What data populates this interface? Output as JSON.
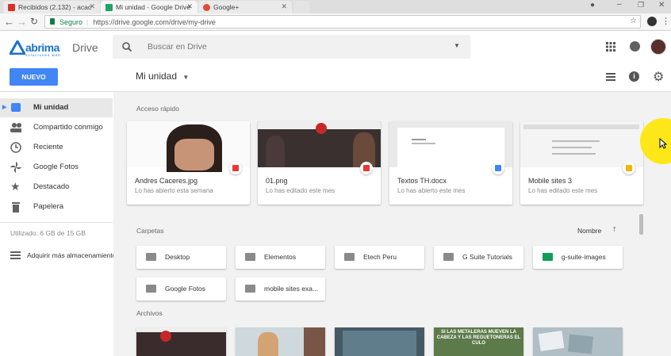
{
  "browser": {
    "tabs": [
      {
        "label": "Recibidos (2.132) - acac",
        "color": "#d93025"
      },
      {
        "label": "Mi unidad - Google Drive",
        "color": "#1fa463"
      },
      {
        "label": "Google+",
        "color": "#dd4b39"
      }
    ],
    "secure_label": "Seguro",
    "url": "https://drive.google.com/drive/my-drive"
  },
  "header": {
    "logo_text": "abrima",
    "logo_sub": "soluciones web",
    "product": "Drive",
    "search_placeholder": "Buscar en Drive"
  },
  "toolbar": {
    "new_label": "NUEVO",
    "title": "Mi unidad"
  },
  "sidebar": {
    "items": [
      {
        "label": "Mi unidad",
        "icon": "drive-icon"
      },
      {
        "label": "Compartido conmigo",
        "icon": "people-icon"
      },
      {
        "label": "Reciente",
        "icon": "clock-icon"
      },
      {
        "label": "Google Fotos",
        "icon": "pinwheel-icon"
      },
      {
        "label": "Destacado",
        "icon": "star-icon"
      },
      {
        "label": "Papelera",
        "icon": "trash-icon"
      }
    ],
    "storage": "Utilizado: 6 GB de 15 GB",
    "buy": "Adquirir más almacenamiento"
  },
  "main": {
    "quick_access_label": "Acceso rápido",
    "quick": [
      {
        "name": "Andres Caceres.jpg",
        "sub": "Lo has abierto esta semana",
        "badge": "#e53935"
      },
      {
        "name": "01.png",
        "sub": "Lo has editado este mes",
        "badge": "#e53935"
      },
      {
        "name": "Textos TH.docx",
        "sub": "Lo has abierto este mes",
        "badge": "#4285f4"
      },
      {
        "name": "Mobile sites 3",
        "sub": "Lo has editado este mes",
        "badge": "#f4b400"
      }
    ],
    "folders_label": "Carpetas",
    "sort_label": "Nombre",
    "folders": [
      {
        "label": "Desktop",
        "color": "#8a8a8a"
      },
      {
        "label": "Elementos",
        "color": "#8a8a8a"
      },
      {
        "label": "Etech Peru",
        "color": "#8a8a8a"
      },
      {
        "label": "G Suite Tutorials",
        "color": "#8a8a8a"
      },
      {
        "label": "g-suite-images",
        "color": "#0f9d58"
      },
      {
        "label": "Google Fotos",
        "color": "#8a8a8a"
      },
      {
        "label": "mobile sites exa...",
        "color": "#8a8a8a"
      }
    ],
    "files_label": "Archivos",
    "file_thumb_text": "SI LAS METALERAS MUEVEN LA CABEZA Y LAS REGUETONERAS EL CULO"
  }
}
